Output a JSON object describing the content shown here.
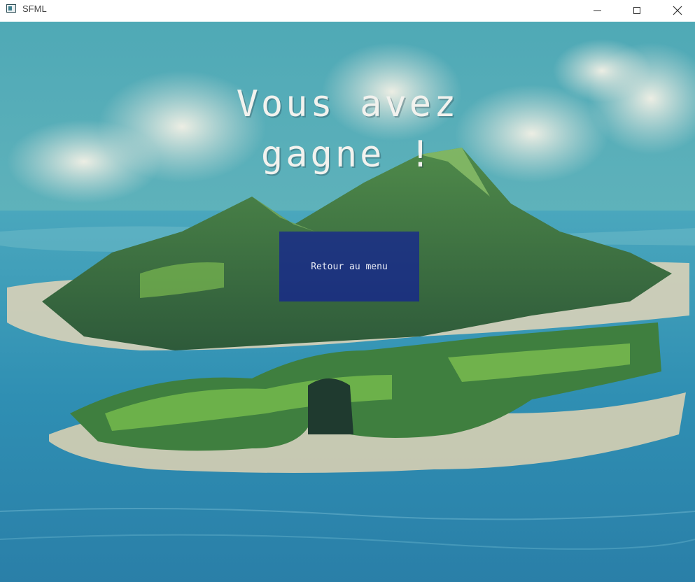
{
  "window": {
    "title": "SFML",
    "icon": "sfml-app-icon",
    "controls": [
      "minimize-icon",
      "maximize-icon",
      "close-icon"
    ]
  },
  "screen": {
    "message_line1": "Vous avez",
    "message_line2": "gagne !",
    "button_label": "Retour au menu"
  },
  "colors": {
    "button_fill": "#121e96",
    "title_text": "#f2f2ee",
    "sea": "#2f8fb0",
    "sky": "#5fb6c0"
  }
}
